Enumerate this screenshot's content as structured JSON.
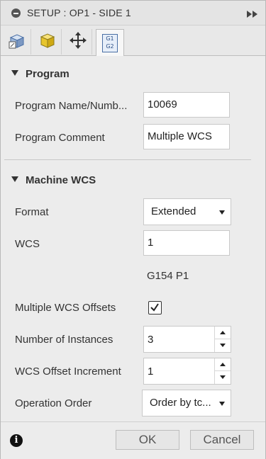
{
  "window": {
    "title": "SETUP : OP1 - SIDE 1"
  },
  "tabs": [
    {
      "icon": "setup-stock-icon"
    },
    {
      "icon": "stock-box-icon"
    },
    {
      "icon": "move-arrows-icon"
    },
    {
      "icon": "g1-g2-post-icon",
      "label_top": "G1",
      "label_bottom": "G2"
    }
  ],
  "program": {
    "header": "Program",
    "name_label": "Program Name/Numb...",
    "name_value": "10069",
    "comment_label": "Program Comment",
    "comment_value": "Multiple WCS"
  },
  "machine_wcs": {
    "header": "Machine WCS",
    "format_label": "Format",
    "format_value": "Extended",
    "wcs_label": "WCS",
    "wcs_value": "1",
    "wcs_code": "G154 P1",
    "multiple_offsets_label": "Multiple WCS Offsets",
    "multiple_offsets_checked": true,
    "instances_label": "Number of Instances",
    "instances_value": "3",
    "increment_label": "WCS Offset Increment",
    "increment_value": "1",
    "order_label": "Operation Order",
    "order_value": "Order by tc..."
  },
  "footer": {
    "ok_label": "OK",
    "cancel_label": "Cancel"
  }
}
